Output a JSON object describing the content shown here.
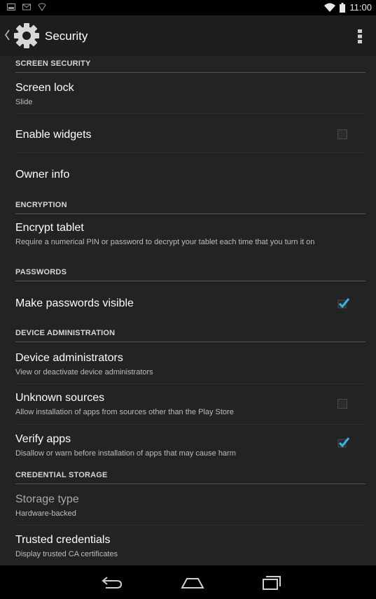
{
  "status": {
    "time": "11:00"
  },
  "header": {
    "title": "Security"
  },
  "sections": {
    "screen_security": "SCREEN SECURITY",
    "encryption": "ENCRYPTION",
    "passwords": "PASSWORDS",
    "device_administration": "DEVICE ADMINISTRATION",
    "credential_storage": "CREDENTIAL STORAGE"
  },
  "items": {
    "screen_lock": {
      "title": "Screen lock",
      "summary": "Slide"
    },
    "enable_widgets": {
      "title": "Enable widgets",
      "checked": false
    },
    "owner_info": {
      "title": "Owner info"
    },
    "encrypt_tablet": {
      "title": "Encrypt tablet",
      "summary": "Require a numerical PIN or password to decrypt your tablet each time that you turn it on"
    },
    "make_passwords_visible": {
      "title": "Make passwords visible",
      "checked": true
    },
    "device_administrators": {
      "title": "Device administrators",
      "summary": "View or deactivate device administrators"
    },
    "unknown_sources": {
      "title": "Unknown sources",
      "summary": "Allow installation of apps from sources other than the Play Store",
      "checked": false
    },
    "verify_apps": {
      "title": "Verify apps",
      "summary": "Disallow or warn before installation of apps that may cause harm",
      "checked": true
    },
    "storage_type": {
      "title": "Storage type",
      "summary": "Hardware-backed"
    },
    "trusted_credentials": {
      "title": "Trusted credentials",
      "summary": "Display trusted CA certificates"
    }
  },
  "colors": {
    "accent": "#33b5e5",
    "background": "#222325"
  },
  "icons": [
    "gallery-icon",
    "gmail-icon",
    "notification-icon",
    "wifi-icon",
    "battery-icon",
    "gear-icon",
    "overflow-menu-icon",
    "back-icon",
    "home-icon",
    "recents-icon"
  ]
}
